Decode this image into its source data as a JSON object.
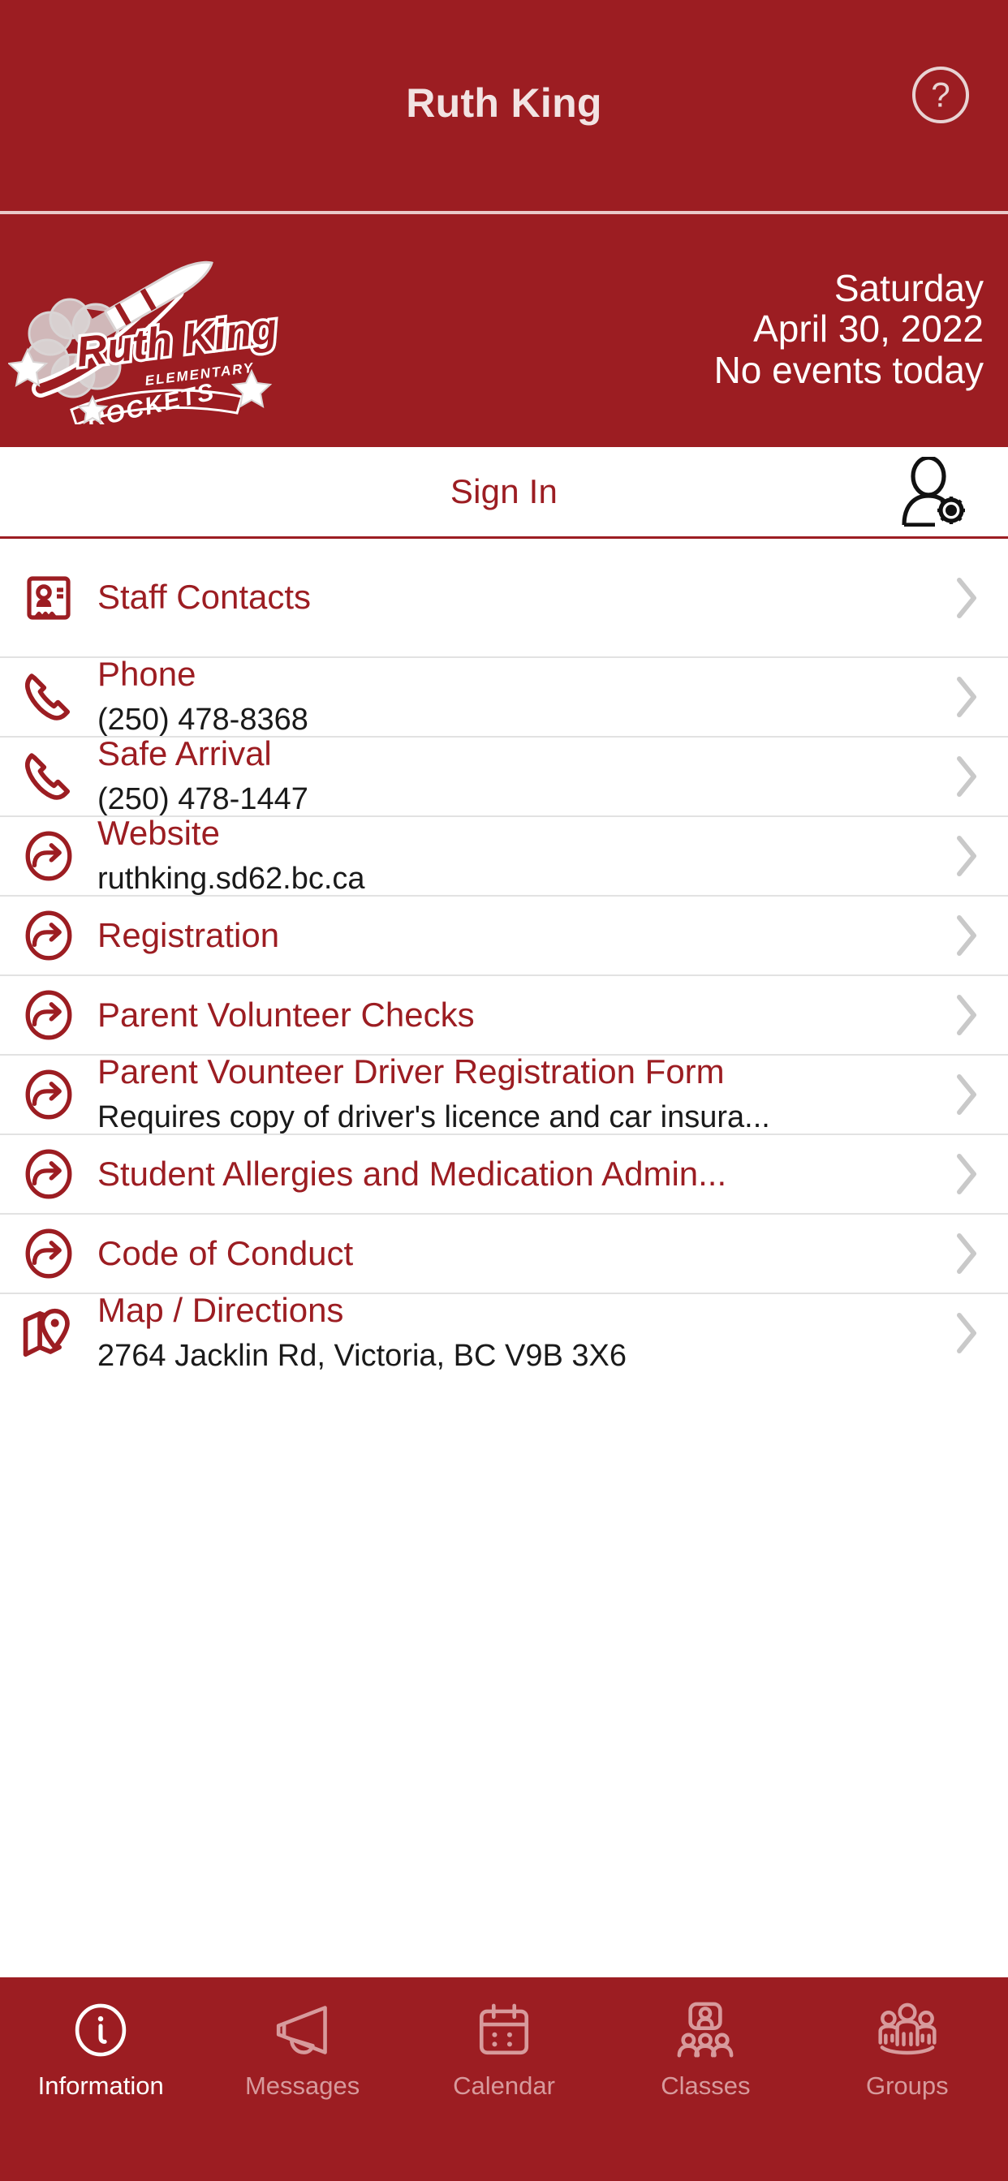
{
  "navbar": {
    "title": "Ruth King",
    "help_icon": "help-circle-icon"
  },
  "banner": {
    "logo_alt": "Ruth King Elementary Rockets",
    "logo_word_main": "Ruth King",
    "logo_word_sub": "ELEMENTARY",
    "logo_word_banner": "ROCKETS",
    "day": "Saturday",
    "date": "April 30, 2022",
    "events": "No events today"
  },
  "signin": {
    "label": "Sign In",
    "account_icon": "user-settings-icon"
  },
  "list": {
    "rows": [
      {
        "icon": "contact-card-icon",
        "title": "Staff Contacts",
        "sub": ""
      },
      {
        "icon": "phone-icon",
        "title": "Phone",
        "sub": "(250) 478-8368"
      },
      {
        "icon": "phone-icon",
        "title": "Safe Arrival",
        "sub": "(250) 478-1447"
      },
      {
        "icon": "external-link-icon",
        "title": "Website",
        "sub": "ruthking.sd62.bc.ca"
      },
      {
        "icon": "external-link-icon",
        "title": "Registration",
        "sub": ""
      },
      {
        "icon": "external-link-icon",
        "title": "Parent Volunteer Checks",
        "sub": ""
      },
      {
        "icon": "external-link-icon",
        "title": "Parent Vounteer Driver Registration Form",
        "sub": "Requires copy of driver's licence and car insura..."
      },
      {
        "icon": "external-link-icon",
        "title": "Student Allergies and Medication Admin...",
        "sub": ""
      },
      {
        "icon": "external-link-icon",
        "title": "Code of Conduct",
        "sub": ""
      },
      {
        "icon": "map-pin-icon",
        "title": "Map / Directions",
        "sub": "2764 Jacklin Rd, Victoria, BC V9B 3X6"
      }
    ],
    "chevron_icon": "chevron-right-icon"
  },
  "tabbar": {
    "tabs": [
      {
        "label": "Information",
        "icon": "info-circle-icon",
        "active": true
      },
      {
        "label": "Messages",
        "icon": "megaphone-icon",
        "active": false
      },
      {
        "label": "Calendar",
        "icon": "calendar-icon",
        "active": false
      },
      {
        "label": "Classes",
        "icon": "classes-icon",
        "active": false
      },
      {
        "label": "Groups",
        "icon": "groups-icon",
        "active": false
      }
    ]
  },
  "colors": {
    "brand_red": "#9C1D22",
    "divider": "#e2e2e2",
    "chevron_gray": "#c9c9c9",
    "inactive_tab": "#d79a9c",
    "subtitle_black": "#1a1a1a"
  }
}
